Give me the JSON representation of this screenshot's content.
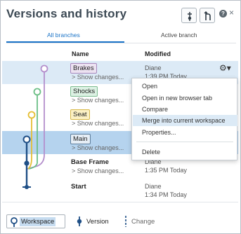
{
  "header": {
    "title": "Versions and history",
    "help_label": "?",
    "close_label": "×"
  },
  "tabs": [
    {
      "label": "All branches",
      "active": true
    },
    {
      "label": "Active branch",
      "active": false
    }
  ],
  "columns": {
    "name": "Name",
    "modified": "Modified"
  },
  "rows": [
    {
      "name": "Brakes",
      "show_changes": "> Show changes...",
      "author": "Diane",
      "time": "1:39 PM Today"
    },
    {
      "name": "Shocks",
      "show_changes": "> Show changes...",
      "author": "",
      "time": ""
    },
    {
      "name": "Seat",
      "show_changes": "> Show changes...",
      "author": "",
      "time": ""
    },
    {
      "name": "Main",
      "show_changes": "> Show changes...",
      "author": "",
      "time": ""
    },
    {
      "name": "Base Frame",
      "show_changes": "> Show changes...",
      "author": "Diane",
      "time": "1:35 PM Today"
    },
    {
      "name": "Start",
      "show_changes": "",
      "author": "Diane",
      "time": "1:34 PM Today"
    }
  ],
  "branch_colors": {
    "brakes": "#b48fcc",
    "shocks": "#6cbf86",
    "seat": "#e5be33",
    "main": "#1f4f86"
  },
  "row_actions": {
    "gear_label": "⚙▾"
  },
  "context_menu": {
    "items": [
      "Open",
      "Open in new browser tab",
      "Compare",
      "Merge into current workspace",
      "Properties...",
      "Delete"
    ],
    "highlighted": "Merge into current workspace"
  },
  "legend": {
    "workspace": "Workspace",
    "version": "Version",
    "change": "Change"
  }
}
